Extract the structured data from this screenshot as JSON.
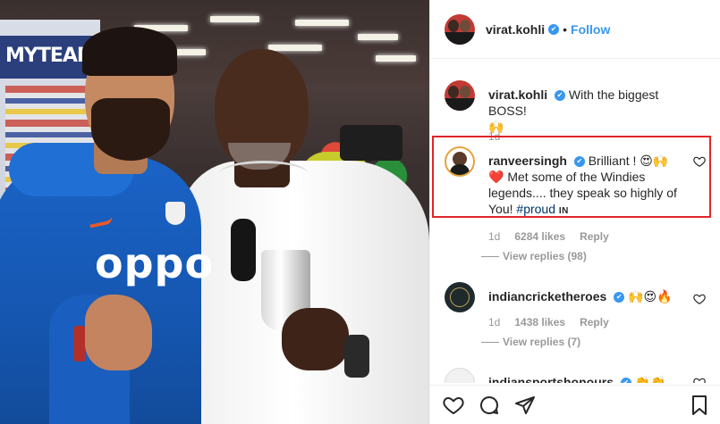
{
  "post": {
    "header": {
      "username": "virat.kohli",
      "verified_mark": "✔",
      "separator": "•",
      "follow_label": "Follow"
    },
    "photo": {
      "banner_text": "MYTEAM11",
      "jersey_text": "oppo"
    },
    "caption": {
      "username": "virat.kohli",
      "text": "With the biggest BOSS!",
      "emoji": "🙌",
      "time": "1d"
    },
    "comments": [
      {
        "username": "ranveersingh",
        "text_1": "Brilliant !",
        "emoji_1": "😍🙌",
        "heart": "❤️",
        "text_2": "Met some of the Windies legends.... they speak so highly of You!",
        "hashtag": "#proud",
        "flag": "IN",
        "time": "1d",
        "likes": "6284 likes",
        "reply": "Reply",
        "view_replies": "View replies (98)",
        "highlighted": true
      },
      {
        "username": "indiancricketheroes",
        "emojis": "🙌😍🔥",
        "time": "1d",
        "likes": "1438 likes",
        "reply": "Reply",
        "view_replies": "View replies (7)"
      },
      {
        "username": "indiansportshonours",
        "emojis": "👏👏"
      }
    ],
    "actions": [
      "heart-icon",
      "comment-icon",
      "share-icon",
      "bookmark-icon"
    ],
    "colors": {
      "accent": "#3897f0",
      "highlight_box": "#e0262a",
      "text": "#262626",
      "meta": "#999999"
    }
  }
}
